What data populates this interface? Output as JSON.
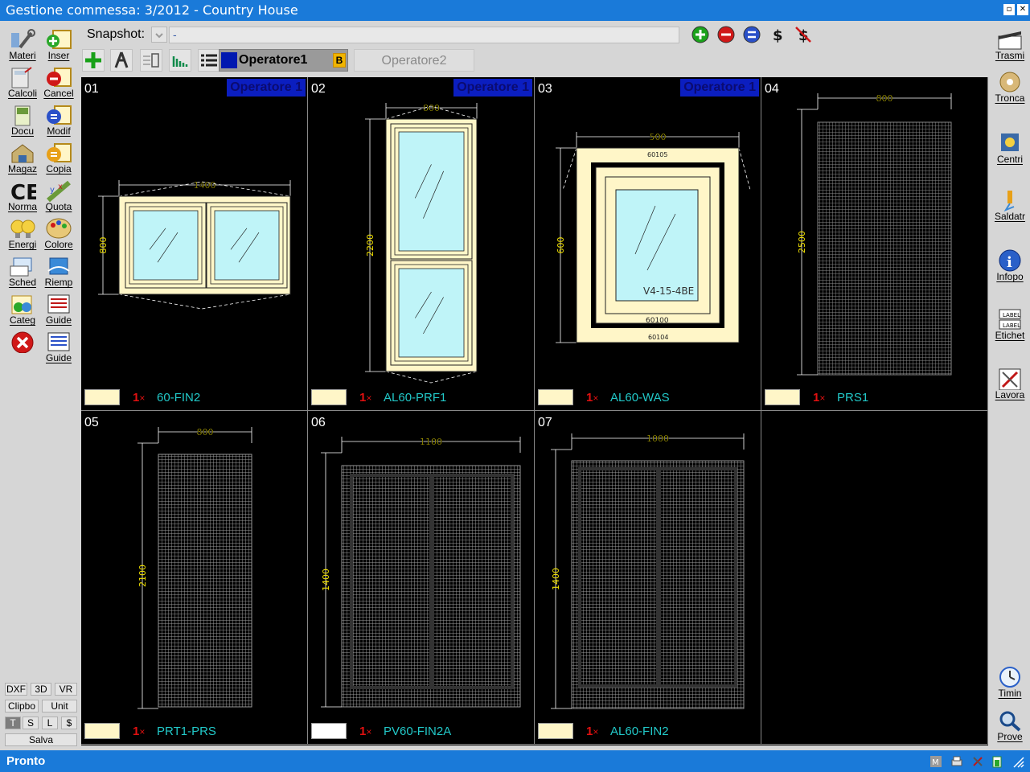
{
  "window": {
    "title": "Gestione commessa: 3/2012 - Country House"
  },
  "left_toolbar": [
    {
      "label": "Materi",
      "icon": "wrench-tools-icon"
    },
    {
      "label": "Inser",
      "icon": "insert-window-icon"
    },
    {
      "label": "Calcoli",
      "icon": "calculator-icon"
    },
    {
      "label": "Cancel",
      "icon": "delete-icon"
    },
    {
      "label": "Docu",
      "icon": "document-icon"
    },
    {
      "label": "Modif",
      "icon": "modify-icon"
    },
    {
      "label": "Magaz",
      "icon": "warehouse-icon"
    },
    {
      "label": "Copia",
      "icon": "copy-icon"
    },
    {
      "label": "Norma",
      "icon": "ce-mark-icon"
    },
    {
      "label": "Quota",
      "icon": "quota-icon"
    },
    {
      "label": "Energi",
      "icon": "lightbulb-icon"
    },
    {
      "label": "Colore",
      "icon": "palette-icon"
    },
    {
      "label": "Sched",
      "icon": "schedule-icon"
    },
    {
      "label": "Riemp",
      "icon": "fill-icon"
    },
    {
      "label": "Categ",
      "icon": "category-icon"
    },
    {
      "label": "Guide",
      "icon": "guide-icon"
    },
    {
      "label": "",
      "icon": "close-icon"
    },
    {
      "label": "Guide",
      "icon": "guide2-icon"
    }
  ],
  "left_small_buttons": {
    "dxf": "DXF",
    "three_d": "3D",
    "vr": "VR",
    "clipbo": "Clipbo",
    "unit": "Unit",
    "t": "T",
    "s": "S",
    "l": "L",
    "dollar": "$",
    "salva": "Salva"
  },
  "right_toolbar": [
    {
      "label": "Trasmi",
      "icon": "clapperboard-icon"
    },
    {
      "label": "Tronca",
      "icon": "cut-roll-icon"
    },
    {
      "label": "Centri",
      "icon": "machining-center-icon"
    },
    {
      "label": "Saldatr",
      "icon": "welder-icon"
    },
    {
      "label": "Infopo",
      "icon": "info-icon"
    },
    {
      "label": "Etichet",
      "icon": "label-icon"
    },
    {
      "label": "Lavora",
      "icon": "work-icon"
    },
    {
      "label": "Timin",
      "icon": "clock-icon"
    },
    {
      "label": "Prove",
      "icon": "magnifier-icon"
    }
  ],
  "snapshot": {
    "label": "Snapshot:",
    "value": "-"
  },
  "round_buttons": [
    {
      "icon": "add-circle-icon",
      "color": "#1aa21a"
    },
    {
      "icon": "remove-circle-icon",
      "color": "#d01818"
    },
    {
      "icon": "swap-circle-icon",
      "color": "#2a50c8"
    },
    {
      "icon": "dollar-icon",
      "text": "$"
    },
    {
      "icon": "no-dollar-icon",
      "text": "$"
    }
  ],
  "tabs": {
    "operator1": {
      "label": "Operatore1",
      "badge": "B"
    },
    "operator2": {
      "label": "Operatore2"
    }
  },
  "cells": [
    {
      "num": "01",
      "operator": "Operatore 1",
      "qty": "1",
      "qty_mark": "×",
      "code": "60-FIN2",
      "color": "#fff6c8",
      "dim_w": "1400",
      "dim_h": "800"
    },
    {
      "num": "02",
      "operator": "Operatore 1",
      "qty": "1",
      "qty_mark": "×",
      "code": "AL60-PRF1",
      "color": "#fff6c8",
      "dim_w": "800",
      "dim_h": "2200"
    },
    {
      "num": "03",
      "operator": "Operatore 1",
      "qty": "1",
      "qty_mark": "×",
      "code": "AL60-WAS",
      "color": "#fff6c8",
      "dim_w": "500",
      "dim_h": "600",
      "glass": "V4-15-4BE",
      "profiles": [
        "60105",
        "60100",
        "60104"
      ]
    },
    {
      "num": "04",
      "operator": "",
      "qty": "1",
      "qty_mark": "×",
      "code": "PRS1",
      "color": "#fff6c8",
      "dim_w": "800",
      "dim_h": "2500"
    },
    {
      "num": "05",
      "operator": "",
      "qty": "1",
      "qty_mark": "×",
      "code": "PRT1-PRS",
      "color": "#fff6c8",
      "dim_w": "800",
      "dim_h": "2100"
    },
    {
      "num": "06",
      "operator": "",
      "qty": "1",
      "qty_mark": "×",
      "code": "PV60-FIN2A",
      "color": "#ffffff",
      "dim_w": "1100",
      "dim_h": "1400"
    },
    {
      "num": "07",
      "operator": "",
      "qty": "1",
      "qty_mark": "×",
      "code": "AL60-FIN2",
      "color": "#fff6c8",
      "dim_w": "1000",
      "dim_h": "1400"
    }
  ],
  "status": {
    "text": "Pronto"
  }
}
